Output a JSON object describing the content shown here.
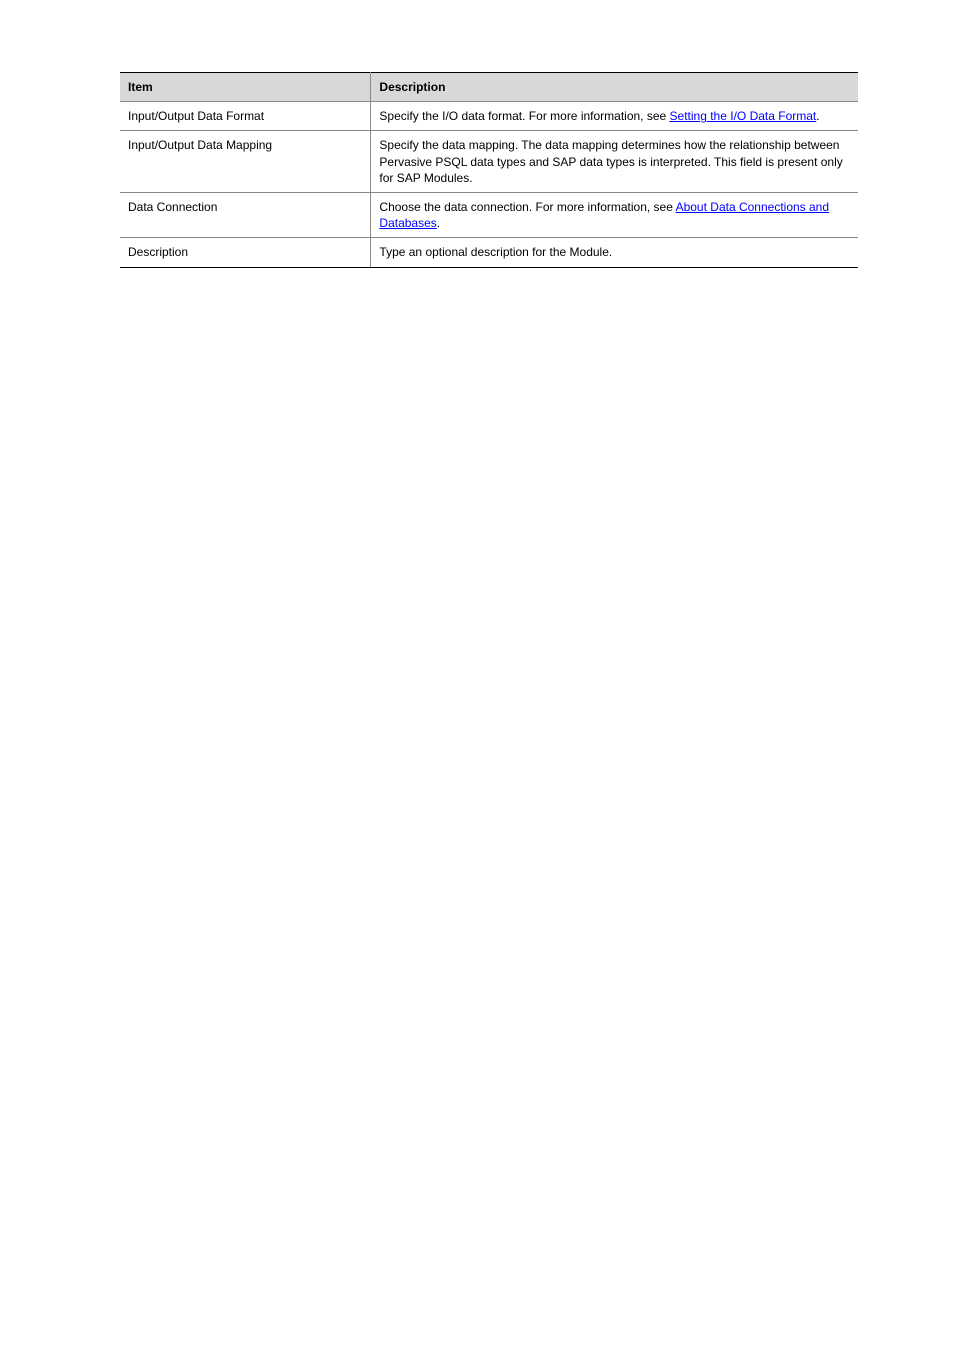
{
  "table": {
    "headers": {
      "item": "Item",
      "description": "Description"
    },
    "rows": [
      {
        "item": "Input/Output Data Format",
        "desc_before": "Specify the I/O data format. For more information, see ",
        "link_text": "Setting the I/O Data Format",
        "desc_after": "."
      },
      {
        "item": "Input/Output Data Mapping",
        "desc": "Specify the data mapping. The data mapping determines how the relationship between Pervasive PSQL data types and SAP data types is interpreted. This field is present only for SAP Modules."
      },
      {
        "item": "Data Connection",
        "desc_before": "Choose the data connection. For more information, see ",
        "link_text": "About Data Connections and Databases",
        "desc_after": "."
      },
      {
        "item": "Description",
        "desc_plain": "Type an optional description for the Module."
      }
    ]
  }
}
